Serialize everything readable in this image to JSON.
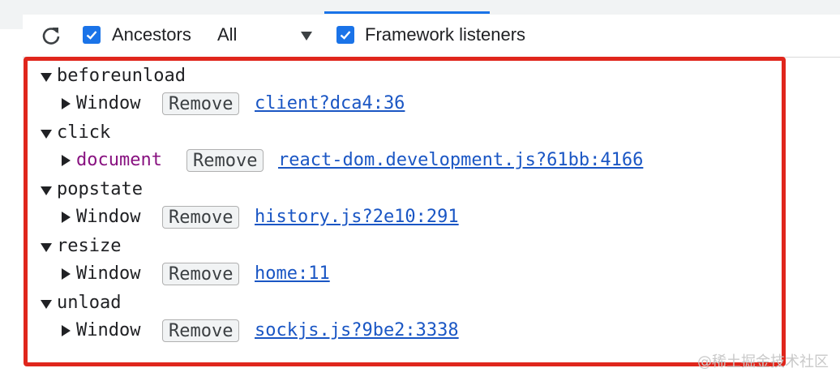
{
  "toolbar": {
    "ancestors_label": "Ancestors",
    "filter_value": "All",
    "framework_label": "Framework listeners",
    "ancestors_checked": true,
    "framework_checked": true
  },
  "listeners": [
    {
      "event": "beforeunload",
      "target": "Window",
      "remove_label": "Remove",
      "source": "client?dca4:36"
    },
    {
      "event": "click",
      "target": "document",
      "remove_label": "Remove",
      "source": "react-dom.development.js?61bb:4166"
    },
    {
      "event": "popstate",
      "target": "Window",
      "remove_label": "Remove",
      "source": "history.js?2e10:291"
    },
    {
      "event": "resize",
      "target": "Window",
      "remove_label": "Remove",
      "source": "home:11"
    },
    {
      "event": "unload",
      "target": "Window",
      "remove_label": "Remove",
      "source": "sockjs.js?9be2:3338"
    }
  ],
  "watermark": "@稀土掘金技术社区",
  "colors": {
    "accent": "#1a73e8",
    "highlight_border": "#e0261c",
    "link": "#1a56c4",
    "node_name": "#881280"
  }
}
